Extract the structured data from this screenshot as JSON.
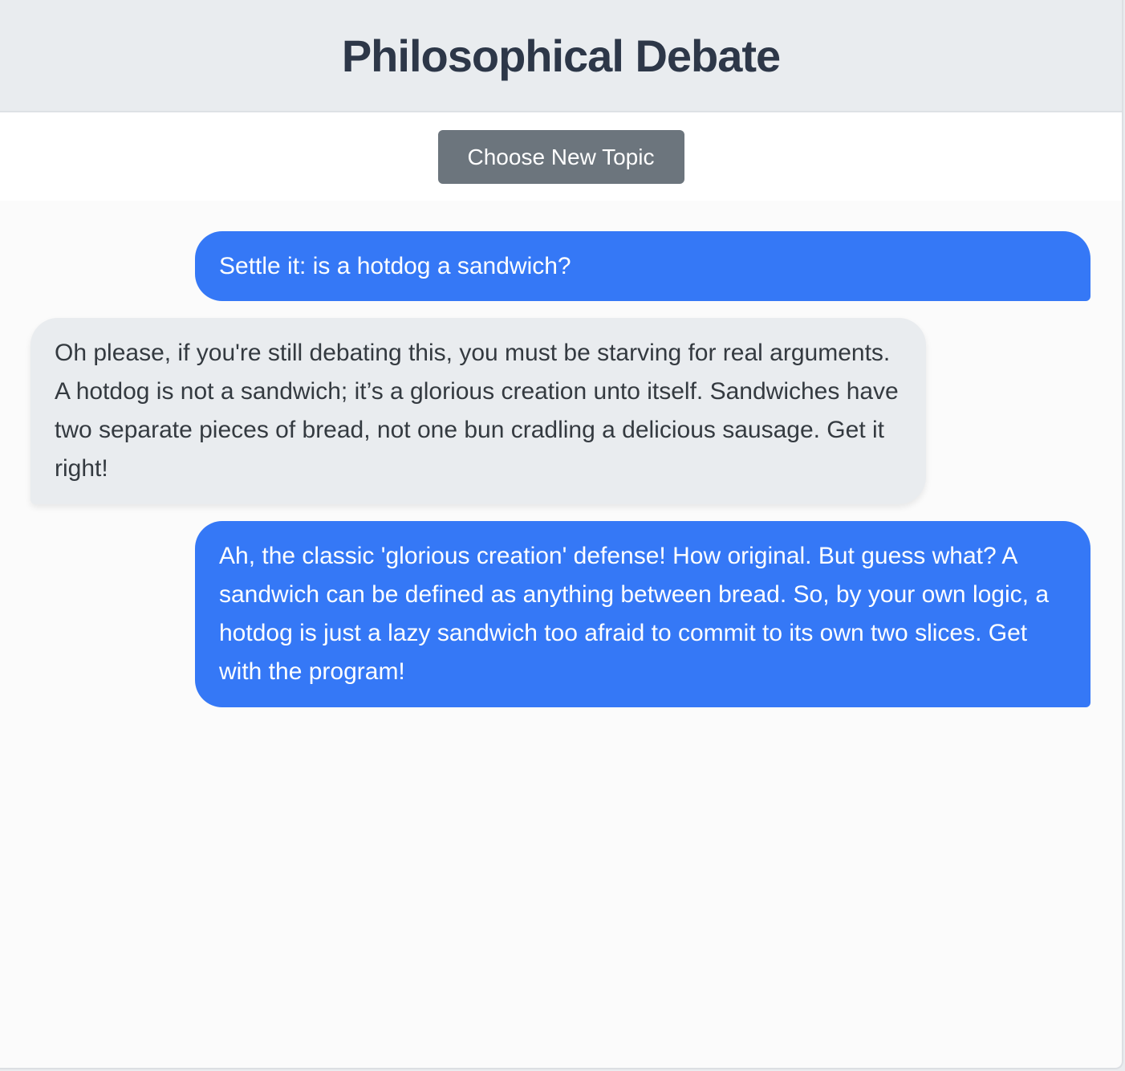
{
  "header": {
    "title": "Philosophical Debate"
  },
  "toolbar": {
    "new_topic_label": "Choose New Topic"
  },
  "messages": [
    {
      "role": "user",
      "text": "Settle it: is a hotdog a sandwich?"
    },
    {
      "role": "bot",
      "text": "Oh please, if you're still debating this, you must be starving for real arguments. A hotdog is not a sandwich; it’s a glorious creation unto itself. Sandwiches have two separate pieces of bread, not one bun cradling a delicious sausage. Get it right!"
    },
    {
      "role": "user",
      "text": "Ah, the classic 'glorious creation' defense! How original. But guess what? A sandwich can be defined as anything between bread. So, by your own logic, a hotdog is just a lazy sandwich too afraid to commit to its own two slices. Get with the program!"
    }
  ],
  "colors": {
    "user_bubble": "#3578f6",
    "bot_bubble": "#e9ecef",
    "button": "#6c757d",
    "title": "#2d3748"
  }
}
